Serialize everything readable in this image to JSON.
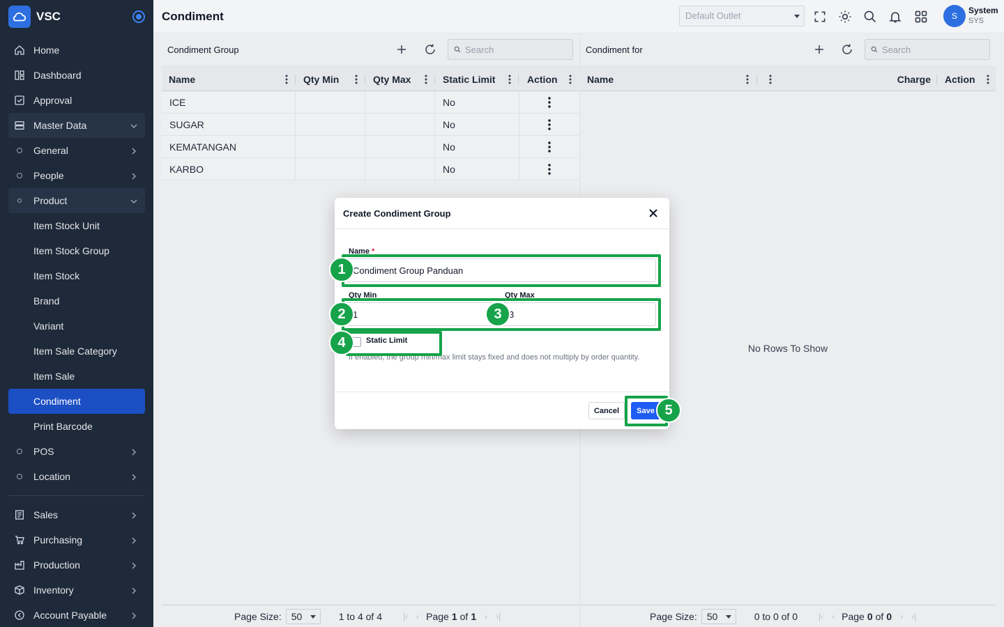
{
  "app": {
    "name": "VSC"
  },
  "sidebar": {
    "items": [
      {
        "label": "Home"
      },
      {
        "label": "Dashboard"
      },
      {
        "label": "Approval"
      },
      {
        "label": "Master Data"
      },
      {
        "label": "General"
      },
      {
        "label": "People"
      },
      {
        "label": "Product"
      },
      {
        "label": "Item Stock Unit"
      },
      {
        "label": "Item Stock Group"
      },
      {
        "label": "Item Stock"
      },
      {
        "label": "Brand"
      },
      {
        "label": "Variant"
      },
      {
        "label": "Item Sale Category"
      },
      {
        "label": "Item Sale"
      },
      {
        "label": "Condiment"
      },
      {
        "label": "Print Barcode"
      },
      {
        "label": "POS"
      },
      {
        "label": "Location"
      },
      {
        "label": "Sales"
      },
      {
        "label": "Purchasing"
      },
      {
        "label": "Production"
      },
      {
        "label": "Inventory"
      },
      {
        "label": "Account Payable"
      }
    ]
  },
  "header": {
    "title": "Condiment",
    "outlet_placeholder": "Default Outlet",
    "user": {
      "initial": "S",
      "name": "System",
      "role": "SYS"
    }
  },
  "left_panel": {
    "title": "Condiment Group",
    "search_placeholder": "Search",
    "columns": [
      "Name",
      "Qty Min",
      "Qty Max",
      "Static Limit",
      "Action"
    ],
    "rows": [
      {
        "name": "ICE",
        "qty_min": "",
        "qty_max": "",
        "static_limit": "No"
      },
      {
        "name": "SUGAR",
        "qty_min": "",
        "qty_max": "",
        "static_limit": "No"
      },
      {
        "name": "KEMATANGAN",
        "qty_min": "",
        "qty_max": "",
        "static_limit": "No"
      },
      {
        "name": "KARBO",
        "qty_min": "",
        "qty_max": "",
        "static_limit": "No"
      }
    ],
    "pager": {
      "size_label": "Page Size:",
      "size": "50",
      "range": "1 to 4 of 4",
      "page_word": "Page",
      "page": "1",
      "of_word": "of",
      "pages": "1"
    }
  },
  "right_panel": {
    "title": "Condiment for",
    "search_placeholder": "Search",
    "columns": [
      "Name",
      "Charge",
      "Action"
    ],
    "empty_text": "No Rows To Show",
    "pager": {
      "size_label": "Page Size:",
      "size": "50",
      "range": "0 to 0 of 0",
      "page_word": "Page",
      "page": "0",
      "of_word": "of",
      "pages": "0"
    }
  },
  "modal": {
    "title": "Create Condiment Group",
    "name_label": "Name",
    "name_required": "*",
    "name_value": "Condiment Group Panduan",
    "qty_min_label": "Qty Min",
    "qty_min_value": "1",
    "qty_max_label": "Qty Max",
    "qty_max_value": "3",
    "static_limit_label": "Static Limit",
    "static_limit_checked": false,
    "hint": "If enabled, the group min/max limit stays fixed and does not multiply by order quantity.",
    "cancel_label": "Cancel",
    "save_label": "Save"
  },
  "annotations": [
    "1",
    "2",
    "3",
    "4",
    "5"
  ],
  "colors": {
    "sidebar_bg": "#1e2939",
    "active": "#1d4fc4",
    "primary": "#1d5cf5",
    "highlight": "#16a34a"
  }
}
